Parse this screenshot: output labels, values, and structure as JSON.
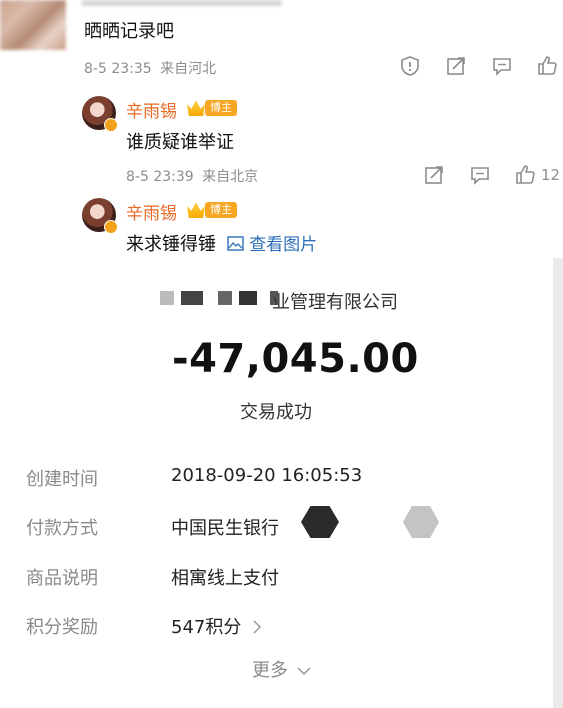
{
  "top_comment": {
    "text": "晒晒记录吧",
    "time": "8-5 23:35",
    "location": "来自河北",
    "icons": [
      "report-icon",
      "share-icon",
      "comment-icon",
      "like-icon"
    ]
  },
  "replies": [
    {
      "name": "辛雨锡",
      "badge": "博主",
      "text": "谁质疑谁举证",
      "time": "8-5 23:39",
      "location": "来自北京",
      "like_count": "12"
    },
    {
      "name": "辛雨锡",
      "badge": "博主",
      "text": "来求锤得锤",
      "link": "查看图片"
    }
  ],
  "payment": {
    "company": "业管理有限公司",
    "amount": "-47,045.00",
    "status": "交易成功",
    "rows": [
      {
        "label": "创建时间",
        "value": "2018-09-20 16:05:53"
      },
      {
        "label": "付款方式",
        "value": "中国民生银行"
      },
      {
        "label": "商品说明",
        "value": "相寓线上支付"
      },
      {
        "label": "积分奖励",
        "value": "547积分"
      }
    ],
    "more": "更多"
  }
}
